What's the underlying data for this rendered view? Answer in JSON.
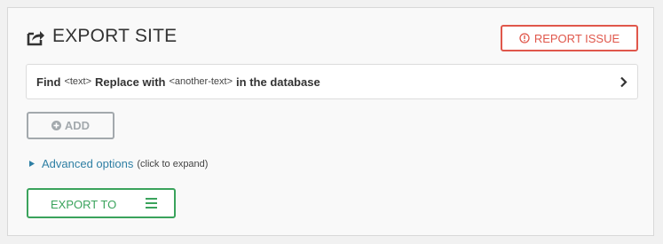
{
  "header": {
    "title": "EXPORT SITE",
    "icon": "export-share-icon",
    "report_label": "REPORT ISSUE"
  },
  "find_replace": {
    "find_label": "Find",
    "find_placeholder": "<text>",
    "replace_label": "Replace with",
    "replace_placeholder": "<another-text>",
    "suffix": "in the database"
  },
  "add_button": {
    "label": "ADD"
  },
  "advanced": {
    "label": "Advanced options",
    "hint": "(click to expand)"
  },
  "export_button": {
    "label": "EXPORT TO"
  },
  "colors": {
    "report": "#e0574b",
    "export": "#3aa35c",
    "link": "#2e7fa4",
    "disabled": "#a3a9ad"
  }
}
